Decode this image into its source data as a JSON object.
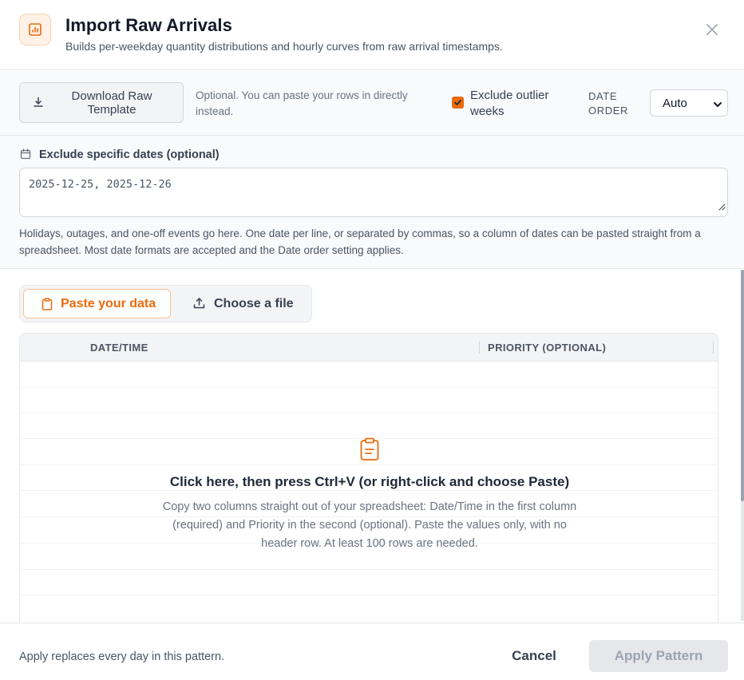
{
  "header": {
    "title": "Import Raw Arrivals",
    "subtitle": "Builds per-weekday quantity distributions and hourly curves from raw arrival timestamps.",
    "icon": "bar-chart-icon",
    "accent_color": "#ea6a0c"
  },
  "options": {
    "download_label": "Download Raw Template",
    "download_note": "Optional. You can paste your rows in directly instead.",
    "exclude_outliers_label": "Exclude outlier weeks",
    "exclude_outliers_checked": true,
    "date_order_label": "DATE ORDER",
    "date_order_value": "Auto"
  },
  "exclude_dates": {
    "title": "Exclude specific dates (optional)",
    "placeholder": "2025-12-25, 2025-12-26",
    "help": "Holidays, outages, and one-off events go here. One date per line, or separated by commas, so a column of dates can be pasted straight from a spreadsheet. Most date formats are accepted and the Date order setting applies."
  },
  "tabs": [
    {
      "label": "Paste your data",
      "active": true
    },
    {
      "label": "Choose a file",
      "active": false
    }
  ],
  "grid": {
    "columns": [
      "DATE/TIME",
      "PRIORITY (OPTIONAL)"
    ],
    "prompt_title": "Click here, then press Ctrl+V (or right-click and choose Paste)",
    "prompt_text": "Copy two columns straight out of your spreadsheet: Date/Time in the first column (required) and Priority in the second (optional). Paste the values only, with no header row. At least 100 rows are needed."
  },
  "footer": {
    "note": "Apply replaces every day in this pattern.",
    "cancel_label": "Cancel",
    "apply_label": "Apply Pattern",
    "apply_enabled": false
  }
}
